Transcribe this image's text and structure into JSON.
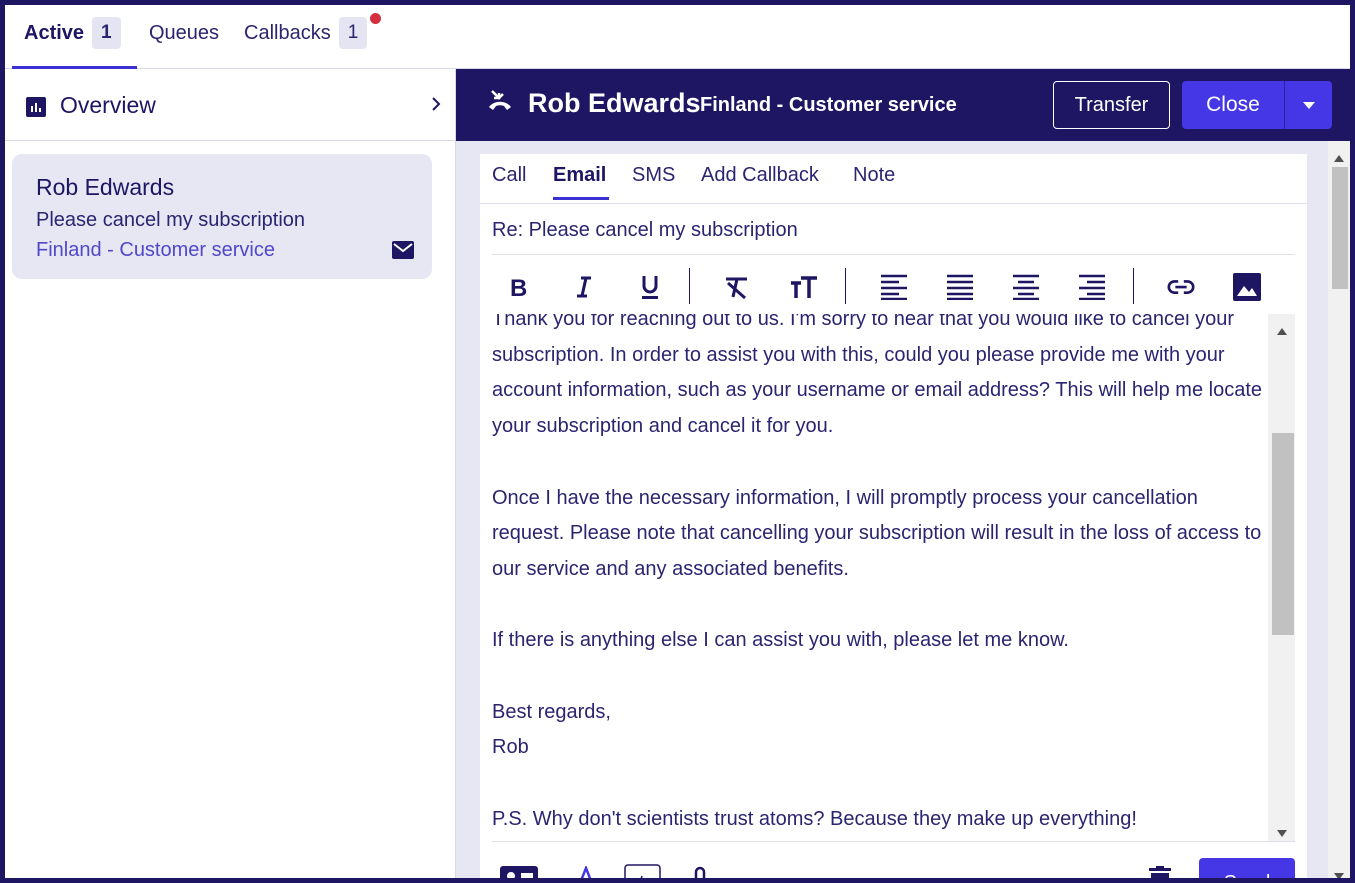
{
  "top_tabs": [
    {
      "label": "Active",
      "count": "1"
    },
    {
      "label": "Queues"
    },
    {
      "label": "Callbacks",
      "count": "1"
    }
  ],
  "sidebar": {
    "overview_label": "Overview",
    "conversation": {
      "name": "Rob Edwards",
      "subject": "Please cancel my subscription",
      "queue": "Finland - Customer service",
      "icon": "mail-icon"
    }
  },
  "header": {
    "contact_name": "Rob Edwards",
    "queue": "Finland - Customer service",
    "transfer_label": "Transfer",
    "close_label": "Close"
  },
  "compose": {
    "tabs": [
      "Call",
      "Email",
      "SMS",
      "Add Callback",
      "Note"
    ],
    "active_tab": "Email",
    "subject": "Re: Please cancel my subscription",
    "body": "Thank you for reaching out to us. I'm sorry to hear that you would like to cancel your subscription. In order to assist you with this, could you please provide me with your account information, such as your username or email address? This will help me locate your subscription and cancel it for you.\n\nOnce I have the necessary information, I will promptly process your cancellation request. Please note that cancelling your subscription will result in the loss of access to our service and any associated benefits.\n\nIf there is anything else I can assist you with, please let me know.\n\nBest regards,\nRob\n\nP.S. Why don't scientists trust atoms? Because they make up everything!",
    "toolbar_icons": [
      "bold-icon",
      "italic-icon",
      "underline-icon",
      "clear-format-icon",
      "text-size-icon",
      "align-left-icon",
      "justify-icon",
      "align-center-icon",
      "align-right-icon",
      "link-icon",
      "image-icon"
    ],
    "send_label": "Send"
  },
  "colors": {
    "navy": "#1e1563",
    "accent": "#4637e6",
    "card_bg": "#e6e7f3",
    "notification": "#d32f3f"
  }
}
